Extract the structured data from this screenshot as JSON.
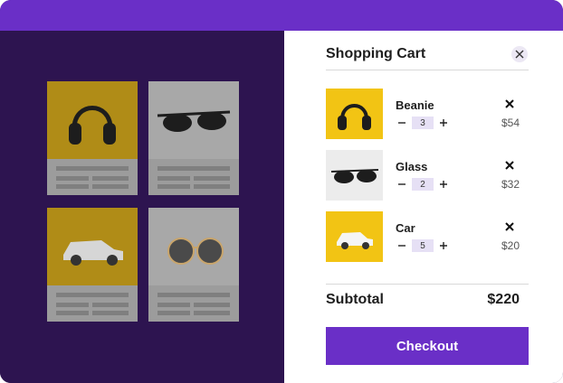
{
  "cart": {
    "title": "Shopping Cart",
    "items": [
      {
        "name": "Beanie",
        "quantity": "3",
        "price": "$54",
        "image": "headphones"
      },
      {
        "name": "Glass",
        "quantity": "2",
        "price": "$32",
        "image": "sunglasses"
      },
      {
        "name": "Car",
        "quantity": "5",
        "price": "$20",
        "image": "toy-car"
      }
    ],
    "subtotal_label": "Subtotal",
    "subtotal_value": "$220",
    "checkout_label": "Checkout"
  },
  "background_products": [
    {
      "image": "headphones"
    },
    {
      "image": "sunglasses"
    },
    {
      "image": "toy-car"
    },
    {
      "image": "round-sunglasses"
    }
  ],
  "colors": {
    "accent": "#6a2fc7",
    "backdrop": "#2d1450",
    "quantity_bg": "#e6e0f5"
  }
}
